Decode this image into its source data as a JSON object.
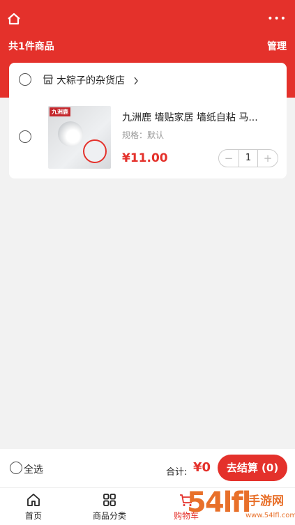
{
  "header": {
    "more_label": "•••",
    "count_text": "共1件商品",
    "manage_label": "管理"
  },
  "store": {
    "name": "大粽子的杂货店"
  },
  "item": {
    "title": "九洲鹿 墙贴家居 墙纸自粘 马...",
    "spec": "规格：默认",
    "price": "¥11.00",
    "quantity": "1",
    "minus": "−",
    "plus": "+",
    "thumb_brand": "九洲鹿"
  },
  "checkout": {
    "select_all_label": "全选",
    "total_label": "合计:",
    "total_value": "¥0",
    "button_label": "去结算 (0)"
  },
  "tabbar": {
    "items": [
      {
        "label": "首页",
        "icon": "home-icon"
      },
      {
        "label": "商品分类",
        "icon": "grid-icon"
      },
      {
        "label": "购物车",
        "icon": "cart-icon"
      }
    ]
  },
  "watermark": {
    "main": "54lfl",
    "top": "手游网",
    "bottom": "www.54lfl.com.cn"
  },
  "colors": {
    "accent": "#e4312b",
    "background": "#f2f2f2"
  }
}
